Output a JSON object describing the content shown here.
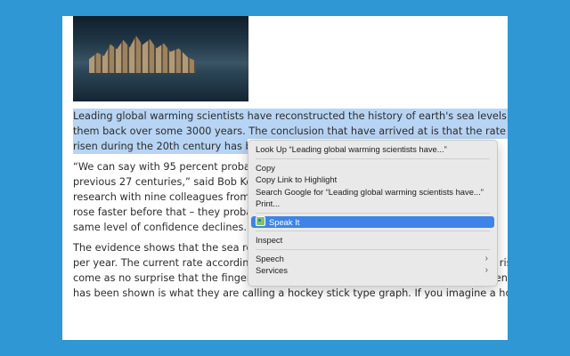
{
  "article": {
    "paragraphs": [
      {
        "highlighted": true,
        "lines": [
          "Leading global warming scientists have reconstructed the history of earth's sea levels, trac",
          "them back over some 3000 years. The conclusion that have arrived at is that the rate the s",
          "risen during the 20th century has be"
        ]
      },
      {
        "highlighted": false,
        "lines": [
          "“We can say with 95 percent probab",
          "previous 27 centuries,” said Bob Kop",
          "research with nine colleagues from",
          "rose faster before that – they probal",
          "same level of confidence declines."
        ]
      },
      {
        "highlighted": false,
        "lines": [
          "The evidence shows that the sea ros",
          "per year. The current rate according to NASA is around 3.4mm and this figure is still rising. I",
          "come as no surprise that the finger is being pointed at global warming for this sudden rise",
          "has been shown is what they are calling a hockey stick type graph. If you imagine a hockey"
        ]
      }
    ]
  },
  "context_menu": {
    "items": [
      {
        "label": "Look Up “Leading global warming scientists have...”"
      },
      {
        "separator": true
      },
      {
        "label": "Copy"
      },
      {
        "label": "Copy Link to Highlight"
      },
      {
        "label": "Search Google for “Leading global warming scientists have...”"
      },
      {
        "label": "Print..."
      },
      {
        "separator": true
      },
      {
        "label": "Speak It",
        "selected": true,
        "icon": "speak-it-extension-icon"
      },
      {
        "separator": true
      },
      {
        "label": "Inspect"
      },
      {
        "separator": true
      },
      {
        "label": "Speech",
        "submenu": true
      },
      {
        "label": "Services",
        "submenu": true
      }
    ],
    "selected_color": "#3e84e6"
  },
  "colors": {
    "background": "#2f97d3",
    "selection_highlight": "#b7d4f4"
  }
}
